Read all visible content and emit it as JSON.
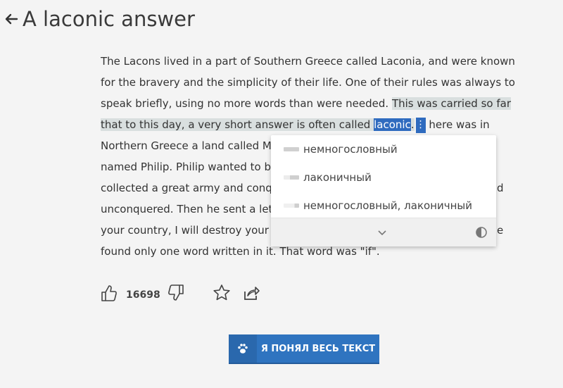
{
  "header": {
    "title": "A laconic answer",
    "back_icon": "arrow-left-icon"
  },
  "article": {
    "lines": [
      "The Lacons lived in a part of Southern Greece called Laconia, and were known",
      "for the bravery and the simplicity of their life. One of their rules was always to",
      {
        "plain": "speak briefly, using no more words than were needed. ",
        "highlight": "This was carried so far"
      },
      {
        "highlight_before": "that to this day, a very short answer is often called ",
        "selected": "laconic",
        "highlight_after": ".",
        "after": "here was in"
      },
      "Northern Greece a land called M",
      "named Philip. Philip wanted to be",
      {
        "text": "collected a great army and conqu",
        "tail": "d"
      },
      "unconquered. Then he sent a let",
      {
        "text": "your country, I will destroy your g",
        "tail": "e"
      },
      "found only one word written in it. That word was \"if\"."
    ],
    "menu_icon": "more-vertical-icon"
  },
  "translation_popup": {
    "items": [
      "немногословный",
      "лаконичный",
      "немногословный, лаконичный"
    ],
    "expand_icon": "chevron-down-icon",
    "contrast_icon": "contrast-icon"
  },
  "actions": {
    "like_count": "16698",
    "like_icon": "thumbs-up-icon",
    "dislike_icon": "thumbs-down-icon",
    "favorite_icon": "star-icon",
    "share_icon": "share-icon"
  },
  "understood_button": {
    "label": "Я ПОНЯЛ ВЕСЬ ТЕКСТ",
    "icon": "paw-icon"
  },
  "colors": {
    "accent": "#2f74c0",
    "highlight": "#d9dfdf",
    "selection": "#2f6bbf"
  }
}
